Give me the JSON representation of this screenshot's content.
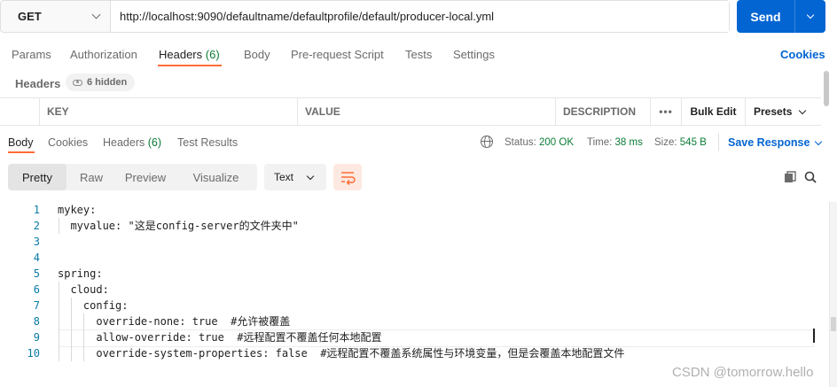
{
  "request": {
    "method": "GET",
    "url": "http://localhost:9090/defaultname/defaultprofile/default/producer-local.yml",
    "send_label": "Send"
  },
  "request_tabs": [
    {
      "label": "Params"
    },
    {
      "label": "Authorization"
    },
    {
      "label": "Headers",
      "count": "(6)",
      "active": true
    },
    {
      "label": "Body"
    },
    {
      "label": "Pre-request Script"
    },
    {
      "label": "Tests"
    },
    {
      "label": "Settings"
    }
  ],
  "cookies_label": "Cookies",
  "headers_section": {
    "label": "Headers",
    "hidden_label": "6 hidden"
  },
  "headers_table": {
    "columns": [
      "KEY",
      "VALUE",
      "DESCRIPTION"
    ],
    "more_label": "•••",
    "bulk_edit": "Bulk Edit",
    "presets": "Presets"
  },
  "response_tabs": [
    {
      "label": "Body",
      "active": true
    },
    {
      "label": "Cookies"
    },
    {
      "label": "Headers",
      "count": "(6)"
    },
    {
      "label": "Test Results"
    }
  ],
  "response_status": {
    "status_label": "Status:",
    "status_value": "200 OK",
    "time_label": "Time:",
    "time_value": "38 ms",
    "size_label": "Size:",
    "size_value": "545 B",
    "save_response": "Save Response"
  },
  "view_modes": [
    "Pretty",
    "Raw",
    "Preview",
    "Visualize"
  ],
  "active_view": "Pretty",
  "format": "Text",
  "code_lines": [
    {
      "n": "1",
      "text": "mykey:"
    },
    {
      "n": "2",
      "text": "  myvalue: \"这是config-server的文件夹中\""
    },
    {
      "n": "3",
      "text": ""
    },
    {
      "n": "4",
      "text": ""
    },
    {
      "n": "5",
      "text": "spring:"
    },
    {
      "n": "6",
      "text": "  cloud:"
    },
    {
      "n": "7",
      "text": "    config:"
    },
    {
      "n": "8",
      "text": "      override-none: true  #允许被覆盖"
    },
    {
      "n": "9",
      "text": "      allow-override: true  #远程配置不覆盖任何本地配置"
    },
    {
      "n": "10",
      "text": "      override-system-properties: false  #远程配置不覆盖系统属性与环境变量，但是会覆盖本地配置文件"
    }
  ],
  "watermark": "CSDN @tomorrow.hello",
  "colors": {
    "accent": "#0265d2",
    "active_tab_underline": "#ff6c37",
    "status_ok": "#0a7c36",
    "line_numbers": "#0a7aa6"
  },
  "icons": [
    "chevron-down-icon",
    "eye-icon",
    "globe-icon",
    "wrap-lines-icon",
    "copy-icon",
    "search-icon"
  ]
}
